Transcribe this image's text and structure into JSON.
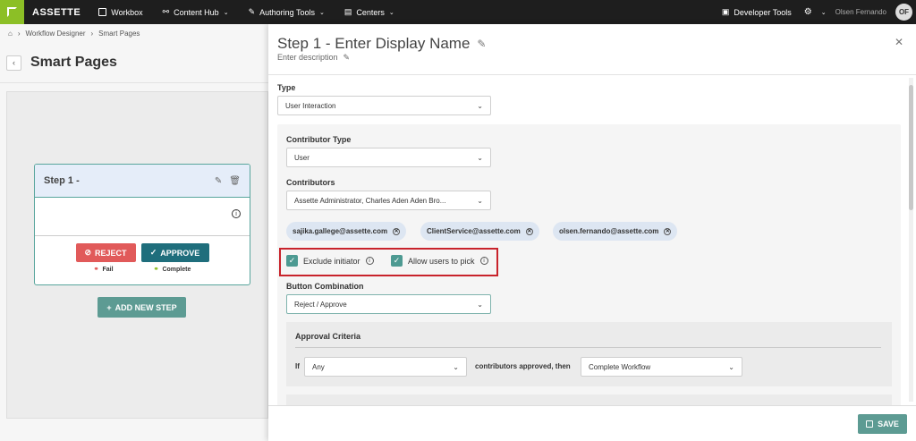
{
  "nav": {
    "brand": "ASSETTE",
    "items": [
      {
        "label": "Workbox",
        "icon": "workbox-icon",
        "caret": ""
      },
      {
        "label": "Content Hub",
        "icon": "share-icon",
        "caret": "⌄"
      },
      {
        "label": "Authoring Tools",
        "icon": "edit-icon",
        "caret": "⌄"
      },
      {
        "label": "Centers",
        "icon": "document-icon",
        "caret": "⌄"
      }
    ],
    "developer_tools": "Developer Tools",
    "user_name": "Olsen Fernando",
    "avatar_initials": "OF"
  },
  "left": {
    "breadcrumb": [
      "Workflow Designer",
      "Smart Pages"
    ],
    "page_title": "Smart Pages",
    "step": {
      "name": "Step 1 -",
      "reject_label": "REJECT",
      "approve_label": "APPROVE",
      "fail_label": "Fail",
      "complete_label": "Complete"
    },
    "add_step_label": "ADD NEW STEP"
  },
  "panel": {
    "title": "Step 1 - Enter Display Name",
    "description_placeholder": "Enter description",
    "type_label": "Type",
    "type_value": "User Interaction",
    "contributor_type_label": "Contributor Type",
    "contributor_type_value": "User",
    "contributors_label": "Contributors",
    "contributors_value": "Assette Administrator, Charles Aden Aden Bro...",
    "chips": [
      "sajika.gallege@assette.com",
      "ClientService@assette.com",
      "olsen.fernando@assette.com"
    ],
    "exclude_initiator_label": "Exclude initiator",
    "allow_pick_label": "Allow users to pick",
    "button_combination_label": "Button Combination",
    "button_combination_value": "Reject / Approve",
    "approval_criteria_title": "Approval Criteria",
    "if_label": "If",
    "any_value": "Any",
    "contributors_approved_label": "contributors approved, then",
    "then_value": "Complete Workflow",
    "save_label": "SAVE"
  }
}
